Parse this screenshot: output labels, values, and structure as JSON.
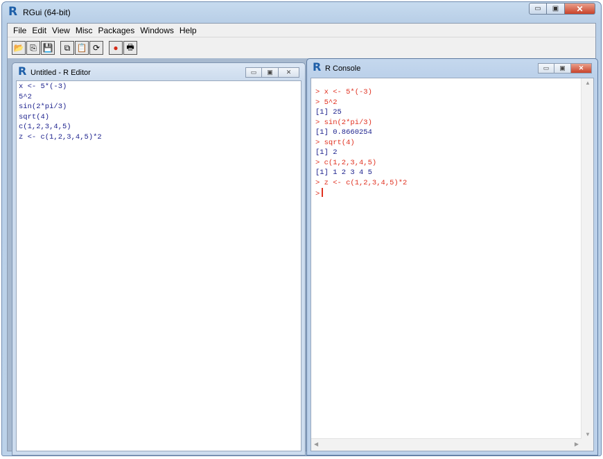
{
  "app": {
    "title": "RGui (64-bit)",
    "logo": "R",
    "window_controls": {
      "minimize": "▭",
      "maximize": "▣",
      "close": "✕"
    }
  },
  "menu": [
    "File",
    "Edit",
    "View",
    "Misc",
    "Packages",
    "Windows",
    "Help"
  ],
  "toolbar": {
    "buttons": [
      {
        "name": "open-script-icon",
        "glyph": "📂"
      },
      {
        "name": "load-workspace-icon",
        "glyph": "⎘"
      },
      {
        "name": "save-workspace-icon",
        "glyph": "💾"
      },
      {
        "name": "copy-icon",
        "glyph": "⧉"
      },
      {
        "name": "paste-icon",
        "glyph": "📋"
      },
      {
        "name": "copy-paste-icon",
        "glyph": "⟳"
      },
      {
        "name": "stop-icon",
        "glyph": "●"
      },
      {
        "name": "print-icon",
        "glyph": "🖶"
      }
    ]
  },
  "editor": {
    "title": "Untitled - R Editor",
    "lines": [
      "x <- 5*(-3)",
      "5^2",
      "sin(2*pi/3)",
      "sqrt(4)",
      "c(1,2,3,4,5)",
      "z <- c(1,2,3,4,5)*2"
    ]
  },
  "console": {
    "title": "R Console",
    "lines": [
      {
        "text": "> x <- 5*(-3)",
        "type": "in"
      },
      {
        "text": "> 5^2",
        "type": "in"
      },
      {
        "text": "[1] 25",
        "type": "out"
      },
      {
        "text": "> sin(2*pi/3)",
        "type": "in"
      },
      {
        "text": "[1] 0.8660254",
        "type": "out"
      },
      {
        "text": "> sqrt(4)",
        "type": "in"
      },
      {
        "text": "[1] 2",
        "type": "out"
      },
      {
        "text": "> c(1,2,3,4,5)",
        "type": "in"
      },
      {
        "text": "[1] 1 2 3 4 5",
        "type": "out"
      },
      {
        "text": "> z <- c(1,2,3,4,5)*2",
        "type": "in"
      }
    ],
    "prompt": ">"
  },
  "colors": {
    "console_input": "#e0301f",
    "console_output": "#1a1f8c",
    "r_logo": "#1e5fa8"
  }
}
